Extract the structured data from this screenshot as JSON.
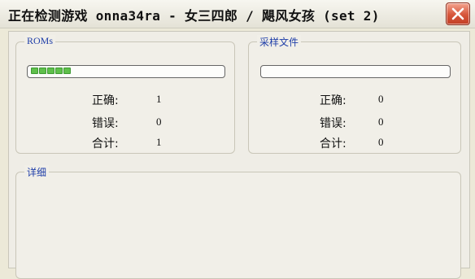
{
  "window": {
    "title": "正在检测游戏 onna34ra - 女三四郎 / 飓风女孩 (set 2)",
    "close_icon": "close-icon"
  },
  "roms": {
    "legend": "ROMs",
    "progress_fraction": 0.21,
    "progress_chunks": 5,
    "correct_label": "正确:",
    "correct_value": "1",
    "error_label": "错误:",
    "error_value": "0",
    "total_label": "合计:",
    "total_value": "1"
  },
  "samples": {
    "legend": "采样文件",
    "progress_fraction": 0,
    "correct_label": "正确:",
    "correct_value": "0",
    "error_label": "错误:",
    "error_value": "0",
    "total_label": "合计:",
    "total_value": "0"
  },
  "details": {
    "legend": "详细"
  },
  "colors": {
    "window_bg": "#ece9d8",
    "legend_text": "#1f3ea8",
    "progress_green": "#5fbf4b",
    "close_button": "#d6553a"
  }
}
